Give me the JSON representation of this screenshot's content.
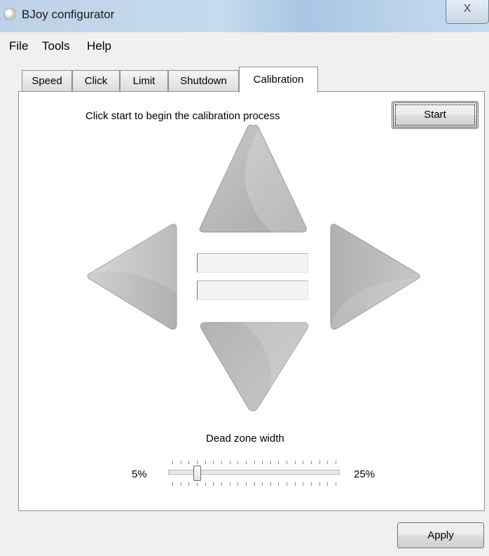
{
  "window": {
    "title": "BJoy configurator",
    "close_glyph": "X"
  },
  "menu": [
    {
      "label": "File",
      "icon": ""
    },
    {
      "label": "Tools"
    },
    {
      "label": "Help"
    }
  ],
  "tabs": [
    {
      "label": "Speed",
      "active": false
    },
    {
      "label": "Click",
      "active": false
    },
    {
      "label": "Limit",
      "active": false
    },
    {
      "label": "Shutdown",
      "active": false
    },
    {
      "label": "Calibration",
      "active": true
    }
  ],
  "calibration": {
    "instruction": "Click start to begin the calibration process",
    "start_label": "Start",
    "arrows": [
      "arrow-up-icon",
      "arrow-left-icon",
      "arrow-right-icon",
      "arrow-down-icon"
    ],
    "field1_value": "",
    "field2_value": "",
    "dead_zone": {
      "label": "Dead zone width",
      "min_label": "5%",
      "max_label": "25%",
      "min": 5,
      "max": 25,
      "value": 8
    }
  },
  "apply_label": "Apply",
  "colors": {
    "arrow_fill": "#b7b7b7",
    "titlebar": "#c7dbee"
  }
}
